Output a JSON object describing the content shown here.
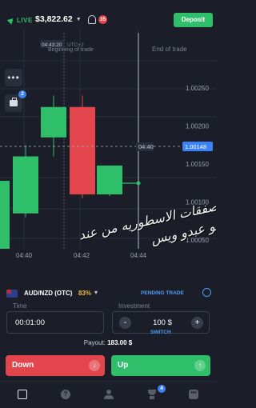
{
  "header": {
    "live_label": "LIVE",
    "balance": "$3,822.62",
    "notifications_count": "35",
    "deposit_label": "Deposit"
  },
  "chart": {
    "time_marker_top": "04:43:20",
    "time_marker_label": "UTC+2",
    "beginning_label": "Beginning of trade",
    "end_label": "End of trade",
    "side_badge": "2",
    "current_price": "1.00148",
    "current_time": "04:40",
    "overlay_text_line1": "صفقات الاسطوريه من عند",
    "overlay_text_line2": "ابو عبدو ويس",
    "trade_markers": [
      "↑",
      "↑"
    ],
    "colors": {
      "up": "#2fbf6a",
      "down": "#e2464c",
      "price_line": "#3b82f6"
    }
  },
  "chart_data": {
    "type": "candlestick",
    "x_ticks": [
      "04:40",
      "04:42",
      "04:44"
    ],
    "y_ticks": [
      "1.00250",
      "1.00200",
      "1.00150",
      "1.00100",
      "1.00050"
    ],
    "candles": [
      {
        "open": 1.00085,
        "close": 1.0016,
        "high": 1.00175,
        "low": 1.0008
      },
      {
        "open": 1.00185,
        "close": 1.00225,
        "high": 1.0024,
        "low": 1.0016
      },
      {
        "open": 1.00225,
        "close": 1.0011,
        "high": 1.0024,
        "low": 1.00105
      },
      {
        "open": 1.0011,
        "close": 1.00148,
        "high": 1.00148,
        "low": 1.00108
      }
    ]
  },
  "trade_panel": {
    "pair": "AUD/NZD (OTC)",
    "payout_pct": "83%",
    "pending_label": "PENDING TRADE",
    "time_label": "Time",
    "time_value": "00:01:00",
    "investment_label": "Investment",
    "investment_value": "100 $",
    "minus": "-",
    "plus": "+",
    "switch_label": "SWITCH",
    "payout_label": "Payout:",
    "payout_value": "183.00 $",
    "down_label": "Down",
    "up_label": "Up",
    "down_icon": "↓",
    "up_icon": "↑"
  },
  "nav": {
    "help_glyph": "?",
    "more_glyph": "•••",
    "trophy_badge": "4"
  }
}
